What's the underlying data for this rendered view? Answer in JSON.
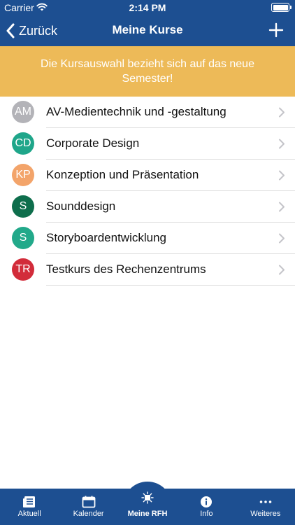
{
  "status_bar": {
    "carrier": "Carrier",
    "time": "2:14 PM"
  },
  "nav": {
    "back_label": "Zurück",
    "title": "Meine Kurse"
  },
  "banner": {
    "text": "Die Kursauswahl bezieht sich auf das neue Semester!"
  },
  "courses": [
    {
      "initials": "AM",
      "name": "AV-Medientechnik und -gestaltung",
      "color": "#b3b3b8"
    },
    {
      "initials": "CD",
      "name": "Corporate Design",
      "color": "#1fa68a"
    },
    {
      "initials": "KP",
      "name": "Konzeption und Präsentation",
      "color": "#f3a46a"
    },
    {
      "initials": "S",
      "name": "Sounddesign",
      "color": "#0e6e4c"
    },
    {
      "initials": "S",
      "name": "Storyboardentwicklung",
      "color": "#22a98a"
    },
    {
      "initials": "TR",
      "name": "Testkurs des Rechenzentrums",
      "color": "#d22c3a"
    }
  ],
  "tabs": [
    {
      "label": "Aktuell",
      "icon": "news-icon"
    },
    {
      "label": "Kalender",
      "icon": "calendar-icon"
    },
    {
      "label": "Meine RFH",
      "icon": "university-logo-icon",
      "active": true
    },
    {
      "label": "Info",
      "icon": "info-icon"
    },
    {
      "label": "Weiteres",
      "icon": "more-icon"
    }
  ],
  "colors": {
    "primary": "#1d4f91",
    "banner": "#edba58"
  }
}
